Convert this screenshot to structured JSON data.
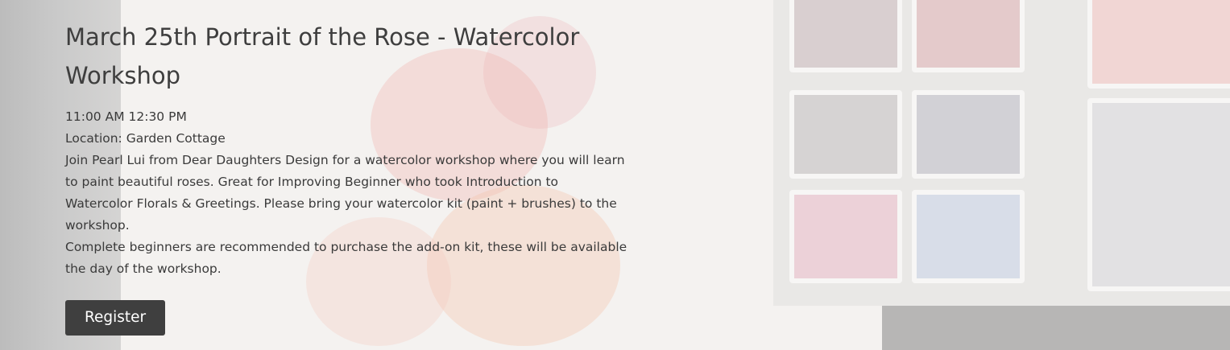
{
  "event": {
    "title": "March 25th Portrait of the Rose - Watercolor Workshop",
    "time": "11:00 AM  12:30 PM",
    "location": "Location: Garden Cottage",
    "description": [
      "Join Pearl Lui from Dear Daughters Design for a watercolor workshop where you will learn to paint beautiful roses. Great for Improving Beginner who took Introduction to Watercolor Florals & Greetings. Please bring your watercolor kit (paint + brushes) to the workshop.",
      "Complete beginners are recommended to purchase the add-on kit, these will be available the day of the workshop."
    ],
    "register_label": "Register"
  },
  "colors": {
    "button_bg": "#3f3f3f",
    "text": "#3b3b3b"
  }
}
